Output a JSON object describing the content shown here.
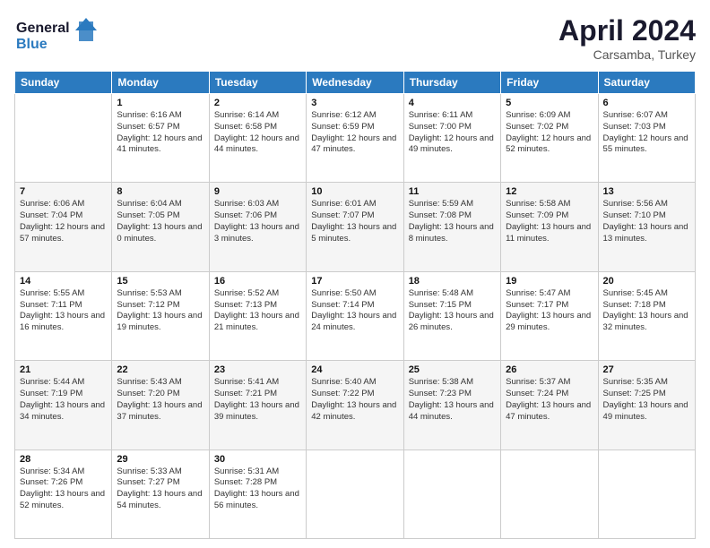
{
  "header": {
    "logo_line1": "General",
    "logo_line2": "Blue",
    "month": "April 2024",
    "location": "Carsamba, Turkey"
  },
  "weekdays": [
    "Sunday",
    "Monday",
    "Tuesday",
    "Wednesday",
    "Thursday",
    "Friday",
    "Saturday"
  ],
  "weeks": [
    [
      {
        "day": "",
        "sunrise": "",
        "sunset": "",
        "daylight": ""
      },
      {
        "day": "1",
        "sunrise": "Sunrise: 6:16 AM",
        "sunset": "Sunset: 6:57 PM",
        "daylight": "Daylight: 12 hours and 41 minutes."
      },
      {
        "day": "2",
        "sunrise": "Sunrise: 6:14 AM",
        "sunset": "Sunset: 6:58 PM",
        "daylight": "Daylight: 12 hours and 44 minutes."
      },
      {
        "day": "3",
        "sunrise": "Sunrise: 6:12 AM",
        "sunset": "Sunset: 6:59 PM",
        "daylight": "Daylight: 12 hours and 47 minutes."
      },
      {
        "day": "4",
        "sunrise": "Sunrise: 6:11 AM",
        "sunset": "Sunset: 7:00 PM",
        "daylight": "Daylight: 12 hours and 49 minutes."
      },
      {
        "day": "5",
        "sunrise": "Sunrise: 6:09 AM",
        "sunset": "Sunset: 7:02 PM",
        "daylight": "Daylight: 12 hours and 52 minutes."
      },
      {
        "day": "6",
        "sunrise": "Sunrise: 6:07 AM",
        "sunset": "Sunset: 7:03 PM",
        "daylight": "Daylight: 12 hours and 55 minutes."
      }
    ],
    [
      {
        "day": "7",
        "sunrise": "Sunrise: 6:06 AM",
        "sunset": "Sunset: 7:04 PM",
        "daylight": "Daylight: 12 hours and 57 minutes."
      },
      {
        "day": "8",
        "sunrise": "Sunrise: 6:04 AM",
        "sunset": "Sunset: 7:05 PM",
        "daylight": "Daylight: 13 hours and 0 minutes."
      },
      {
        "day": "9",
        "sunrise": "Sunrise: 6:03 AM",
        "sunset": "Sunset: 7:06 PM",
        "daylight": "Daylight: 13 hours and 3 minutes."
      },
      {
        "day": "10",
        "sunrise": "Sunrise: 6:01 AM",
        "sunset": "Sunset: 7:07 PM",
        "daylight": "Daylight: 13 hours and 5 minutes."
      },
      {
        "day": "11",
        "sunrise": "Sunrise: 5:59 AM",
        "sunset": "Sunset: 7:08 PM",
        "daylight": "Daylight: 13 hours and 8 minutes."
      },
      {
        "day": "12",
        "sunrise": "Sunrise: 5:58 AM",
        "sunset": "Sunset: 7:09 PM",
        "daylight": "Daylight: 13 hours and 11 minutes."
      },
      {
        "day": "13",
        "sunrise": "Sunrise: 5:56 AM",
        "sunset": "Sunset: 7:10 PM",
        "daylight": "Daylight: 13 hours and 13 minutes."
      }
    ],
    [
      {
        "day": "14",
        "sunrise": "Sunrise: 5:55 AM",
        "sunset": "Sunset: 7:11 PM",
        "daylight": "Daylight: 13 hours and 16 minutes."
      },
      {
        "day": "15",
        "sunrise": "Sunrise: 5:53 AM",
        "sunset": "Sunset: 7:12 PM",
        "daylight": "Daylight: 13 hours and 19 minutes."
      },
      {
        "day": "16",
        "sunrise": "Sunrise: 5:52 AM",
        "sunset": "Sunset: 7:13 PM",
        "daylight": "Daylight: 13 hours and 21 minutes."
      },
      {
        "day": "17",
        "sunrise": "Sunrise: 5:50 AM",
        "sunset": "Sunset: 7:14 PM",
        "daylight": "Daylight: 13 hours and 24 minutes."
      },
      {
        "day": "18",
        "sunrise": "Sunrise: 5:48 AM",
        "sunset": "Sunset: 7:15 PM",
        "daylight": "Daylight: 13 hours and 26 minutes."
      },
      {
        "day": "19",
        "sunrise": "Sunrise: 5:47 AM",
        "sunset": "Sunset: 7:17 PM",
        "daylight": "Daylight: 13 hours and 29 minutes."
      },
      {
        "day": "20",
        "sunrise": "Sunrise: 5:45 AM",
        "sunset": "Sunset: 7:18 PM",
        "daylight": "Daylight: 13 hours and 32 minutes."
      }
    ],
    [
      {
        "day": "21",
        "sunrise": "Sunrise: 5:44 AM",
        "sunset": "Sunset: 7:19 PM",
        "daylight": "Daylight: 13 hours and 34 minutes."
      },
      {
        "day": "22",
        "sunrise": "Sunrise: 5:43 AM",
        "sunset": "Sunset: 7:20 PM",
        "daylight": "Daylight: 13 hours and 37 minutes."
      },
      {
        "day": "23",
        "sunrise": "Sunrise: 5:41 AM",
        "sunset": "Sunset: 7:21 PM",
        "daylight": "Daylight: 13 hours and 39 minutes."
      },
      {
        "day": "24",
        "sunrise": "Sunrise: 5:40 AM",
        "sunset": "Sunset: 7:22 PM",
        "daylight": "Daylight: 13 hours and 42 minutes."
      },
      {
        "day": "25",
        "sunrise": "Sunrise: 5:38 AM",
        "sunset": "Sunset: 7:23 PM",
        "daylight": "Daylight: 13 hours and 44 minutes."
      },
      {
        "day": "26",
        "sunrise": "Sunrise: 5:37 AM",
        "sunset": "Sunset: 7:24 PM",
        "daylight": "Daylight: 13 hours and 47 minutes."
      },
      {
        "day": "27",
        "sunrise": "Sunrise: 5:35 AM",
        "sunset": "Sunset: 7:25 PM",
        "daylight": "Daylight: 13 hours and 49 minutes."
      }
    ],
    [
      {
        "day": "28",
        "sunrise": "Sunrise: 5:34 AM",
        "sunset": "Sunset: 7:26 PM",
        "daylight": "Daylight: 13 hours and 52 minutes."
      },
      {
        "day": "29",
        "sunrise": "Sunrise: 5:33 AM",
        "sunset": "Sunset: 7:27 PM",
        "daylight": "Daylight: 13 hours and 54 minutes."
      },
      {
        "day": "30",
        "sunrise": "Sunrise: 5:31 AM",
        "sunset": "Sunset: 7:28 PM",
        "daylight": "Daylight: 13 hours and 56 minutes."
      },
      {
        "day": "",
        "sunrise": "",
        "sunset": "",
        "daylight": ""
      },
      {
        "day": "",
        "sunrise": "",
        "sunset": "",
        "daylight": ""
      },
      {
        "day": "",
        "sunrise": "",
        "sunset": "",
        "daylight": ""
      },
      {
        "day": "",
        "sunrise": "",
        "sunset": "",
        "daylight": ""
      }
    ]
  ]
}
